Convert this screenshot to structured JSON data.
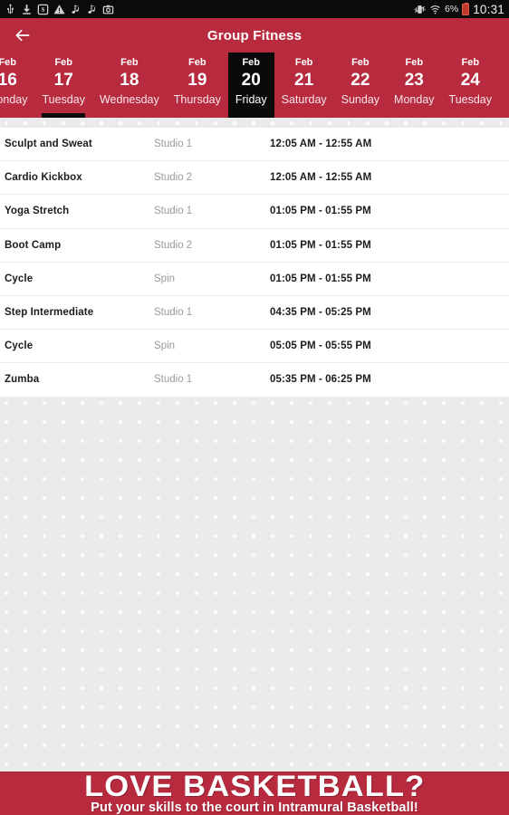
{
  "status_bar": {
    "left_icons": [
      "usb-icon",
      "download-icon",
      "screenshot-badge-icon",
      "warning-icon",
      "music-note-icon",
      "music-note-icon",
      "camera-icon"
    ],
    "right_icons": [
      "vibrate-mute-icon",
      "wifi-icon"
    ],
    "battery_percent": "6%",
    "time": "10:31"
  },
  "app_bar": {
    "back_icon": "arrow-left-icon",
    "title": "Group Fitness"
  },
  "date_tabs": {
    "selected_index": 4,
    "indicated_index": 1,
    "items": [
      {
        "month": "Feb",
        "day": "16",
        "weekday": "Monday"
      },
      {
        "month": "Feb",
        "day": "17",
        "weekday": "Tuesday"
      },
      {
        "month": "Feb",
        "day": "18",
        "weekday": "Wednesday"
      },
      {
        "month": "Feb",
        "day": "19",
        "weekday": "Thursday"
      },
      {
        "month": "Feb",
        "day": "20",
        "weekday": "Friday"
      },
      {
        "month": "Feb",
        "day": "21",
        "weekday": "Saturday"
      },
      {
        "month": "Feb",
        "day": "22",
        "weekday": "Sunday"
      },
      {
        "month": "Feb",
        "day": "23",
        "weekday": "Monday"
      },
      {
        "month": "Feb",
        "day": "24",
        "weekday": "Tuesday"
      }
    ]
  },
  "class_list": {
    "rows": [
      {
        "name": "Sculpt and Sweat",
        "location": "Studio 1",
        "time": "12:05 AM - 12:55 AM"
      },
      {
        "name": "Cardio Kickbox",
        "location": "Studio 2",
        "time": "12:05 AM - 12:55 AM"
      },
      {
        "name": "Yoga Stretch",
        "location": "Studio 1",
        "time": "01:05 PM - 01:55 PM"
      },
      {
        "name": "Boot Camp",
        "location": "Studio 2",
        "time": "01:05 PM - 01:55 PM"
      },
      {
        "name": "Cycle",
        "location": "Spin",
        "time": "01:05 PM - 01:55 PM"
      },
      {
        "name": "Step Intermediate",
        "location": "Studio 1",
        "time": "04:35 PM - 05:25 PM"
      },
      {
        "name": "Cycle",
        "location": "Spin",
        "time": "05:05 PM - 05:55 PM"
      },
      {
        "name": "Zumba",
        "location": "Studio 1",
        "time": "05:35 PM - 06:25 PM"
      }
    ]
  },
  "banner": {
    "headline": "LOVE BASKETBALL?",
    "subline": "Put your skills to the court in Intramural Basketball!"
  },
  "colors": {
    "brand_red": "#b82a3e",
    "selected_black": "#0a0a0a",
    "dot_background": "#ebebeb",
    "text_primary": "#1c1c1c",
    "text_muted": "#9a9a9a"
  }
}
